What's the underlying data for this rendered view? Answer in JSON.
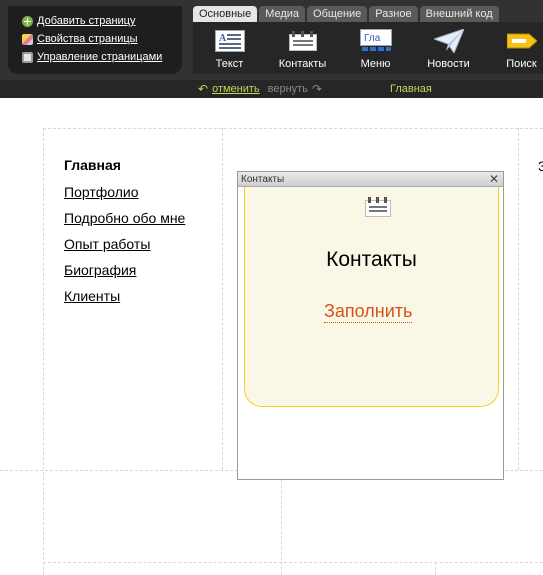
{
  "page_actions": [
    {
      "label": "Добавить страницу",
      "icon": "plus-circle-icon"
    },
    {
      "label": "Свойства страницы",
      "icon": "pencil-icon"
    },
    {
      "label": "Управление страницами",
      "icon": "settings-icon"
    }
  ],
  "tabs": [
    {
      "label": "Основные",
      "active": true
    },
    {
      "label": "Медиа",
      "active": false
    },
    {
      "label": "Общение",
      "active": false
    },
    {
      "label": "Разное",
      "active": false
    },
    {
      "label": "Внешний код",
      "active": false
    }
  ],
  "tools": [
    {
      "label": "Текст",
      "icon": "text-block-icon"
    },
    {
      "label": "Контакты",
      "icon": "contacts-icon"
    },
    {
      "label": "Меню",
      "icon": "menu-icon",
      "icon_text": "Гла"
    },
    {
      "label": "Новости",
      "icon": "paper-plane-icon"
    },
    {
      "label": "Поиск",
      "icon": "search-tag-icon"
    }
  ],
  "history": {
    "undo_label": "отменить",
    "redo_label": "вернуть"
  },
  "current_page": "Главная",
  "nav_menu": [
    {
      "label": "Главная",
      "current": true
    },
    {
      "label": "Портфолио",
      "current": false
    },
    {
      "label": "Подробно обо мне",
      "current": false
    },
    {
      "label": "Опыт работы",
      "current": false
    },
    {
      "label": "Биография",
      "current": false
    },
    {
      "label": "Клиенты",
      "current": false
    }
  ],
  "edge_text": "З",
  "widget": {
    "window_title": "Контакты",
    "close_glyph": "✕",
    "card_title": "Контакты",
    "fill_link": "Заполнить"
  },
  "colors": {
    "toolbar_bg": "#323232",
    "accent_text": "#c9d35b",
    "card_bg": "#fbf7e6",
    "card_border": "#f2d21e",
    "fill_link": "#d4531a"
  }
}
